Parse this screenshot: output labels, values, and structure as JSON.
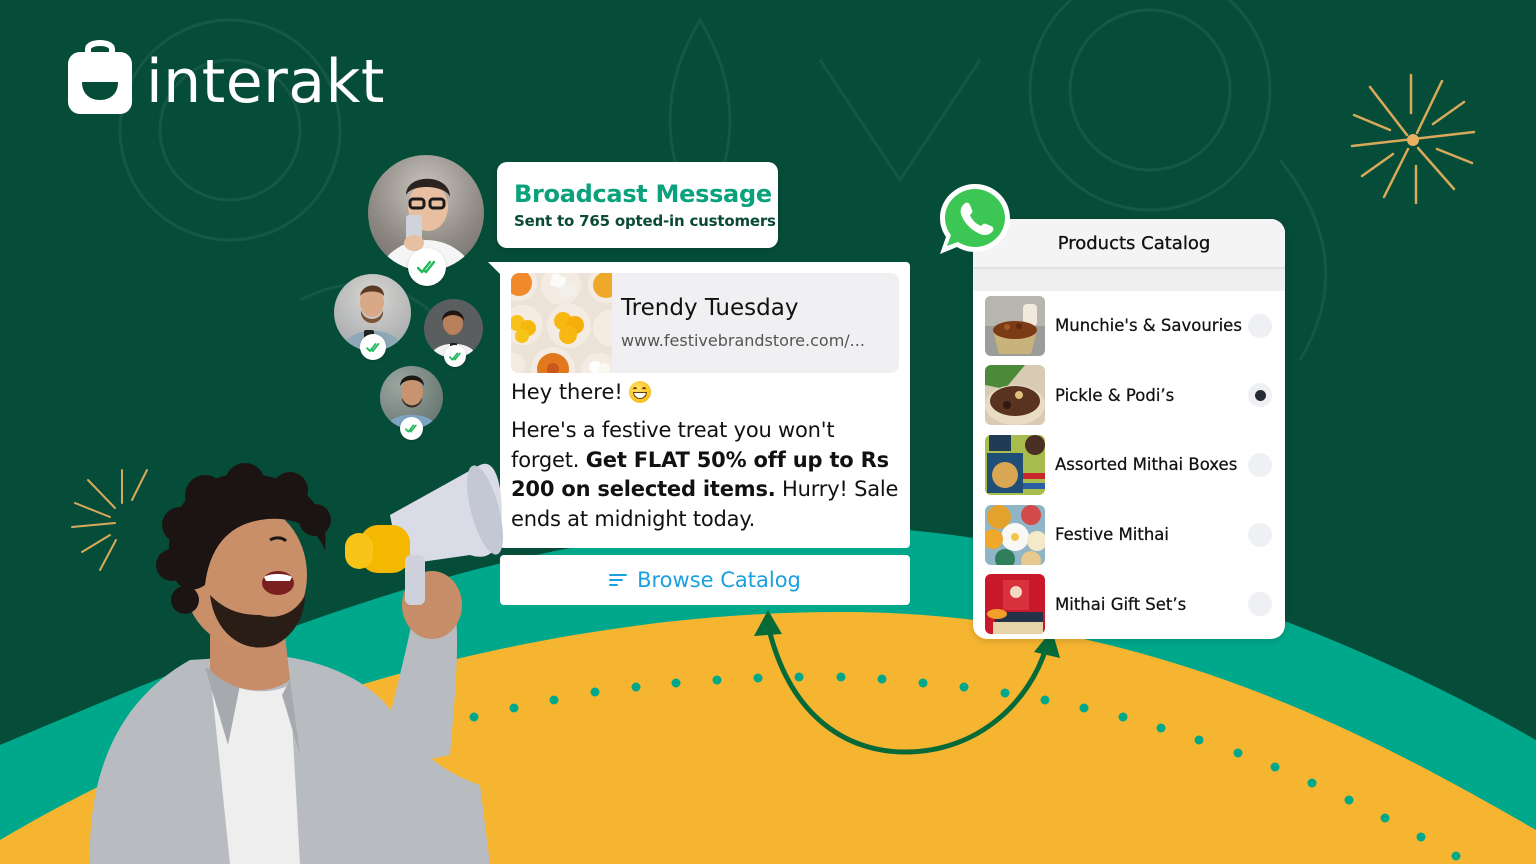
{
  "brand": {
    "name": "interakt",
    "colors": {
      "dark_green": "#064d39",
      "teal": "#00a88b",
      "yellow": "#f6b531",
      "accent_green": "#0aa17d",
      "gold_line": "#d9a95a",
      "link_blue": "#1aa0e0"
    }
  },
  "broadcast": {
    "title": "Broadcast Message",
    "subtitle": "Sent to 765 opted-in customers"
  },
  "message": {
    "preview_title": "Trendy Tuesday",
    "preview_url": "www.festivebrandstore.com/...",
    "greeting": "Hey there!",
    "greeting_emoji": "grinning-face-emoji",
    "body_part1": "Here's a festive treat you won't forget. ",
    "body_bold": "Get FLAT 50% off up to Rs 200 on selected items.",
    "body_part2": " Hurry! Sale ends at midnight today.",
    "cta_label": "Browse Catalog",
    "cta_icon": "list-icon"
  },
  "recipients": [
    {
      "name": "woman-with-glasses",
      "status": "read"
    },
    {
      "name": "man-with-phone",
      "status": "read"
    },
    {
      "name": "woman-smiling",
      "status": "read"
    },
    {
      "name": "man-laughing",
      "status": "read"
    }
  ],
  "catalog": {
    "title": "Products Catalog",
    "app_icon": "whatsapp-icon",
    "items": [
      {
        "label": "Munchie's & Savouries",
        "selected": false
      },
      {
        "label": "Pickle & Podi’s",
        "selected": true
      },
      {
        "label": "Assorted Mithai Boxes",
        "selected": false
      },
      {
        "label": "Festive Mithai",
        "selected": false
      },
      {
        "label": "Mithai Gift Set’s",
        "selected": false
      }
    ]
  }
}
